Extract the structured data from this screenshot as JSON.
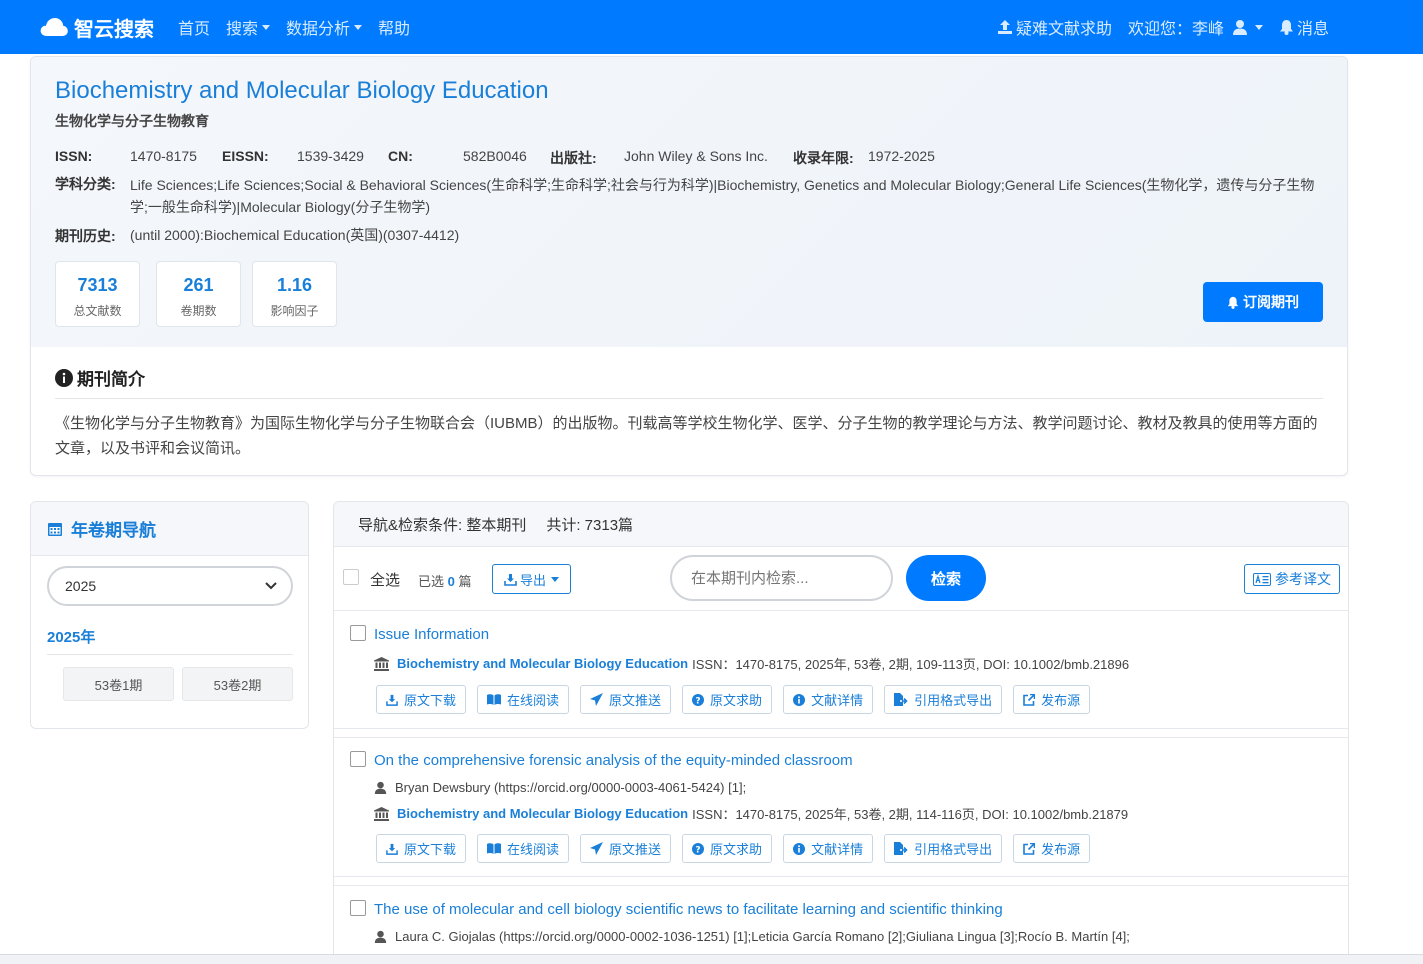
{
  "nav": {
    "brand": "智云搜索",
    "items": [
      "首页",
      "搜索",
      "数据分析",
      "帮助"
    ],
    "help_request": "疑难文献求助",
    "welcome": "欢迎您：李峰",
    "messages": "消息"
  },
  "journal": {
    "title": "Biochemistry and Molecular Biology Education",
    "subtitle": "生物化学与分子生物教育",
    "issn_label": "ISSN:",
    "issn": "1470-8175",
    "eissn_label": "EISSN:",
    "eissn": "1539-3429",
    "cn_label": "CN:",
    "cn": "582B0046",
    "publisher_label": "出版社:",
    "publisher": "John Wiley & Sons Inc.",
    "years_label": "收录年限:",
    "years": "1972-2025",
    "subject_label": "学科分类:",
    "subject": "Life Sciences;Life Sciences;Social & Behavioral Sciences(生命科学;生命科学;社会与行为科学)|Biochemistry, Genetics and Molecular Biology;General Life Sciences(生物化学，遗传与分子生物学;一般生命科学)|Molecular Biology(分子生物学)",
    "history_label": "期刊历史:",
    "history": "(until 2000):Biochemical Education(英国)(0307-4412)",
    "stats": [
      {
        "num": "7313",
        "label": "总文献数"
      },
      {
        "num": "261",
        "label": "卷期数"
      },
      {
        "num": "1.16",
        "label": "影响因子"
      }
    ],
    "subscribe": "订阅期刊",
    "intro_title": "期刊简介",
    "intro_text": "《生物化学与分子生物教育》为国际生物化学与分子生物联合会（IUBMB）的出版物。刊载高等学校生物化学、医学、分子生物的教学理论与方法、教学问题讨论、教材及教具的使用等方面的文章，以及书评和会议简讯。"
  },
  "sidebar": {
    "title": "年卷期导航",
    "selected_year": "2025",
    "year_label": "2025年",
    "issues": [
      "53卷1期",
      "53卷2期"
    ]
  },
  "results": {
    "condition_label": "导航&检索条件: 整本期刊",
    "total_label": "共计: 7313篇",
    "select_all": "全选",
    "selected_prefix": "已选",
    "selected_count": "0",
    "selected_suffix": "篇",
    "export": "导出",
    "search_placeholder": "在本期刊内检索...",
    "search_button": "检索",
    "translate": "参考译文",
    "actions": [
      "原文下载",
      "在线阅读",
      "原文推送",
      "原文求助",
      "文献详情",
      "引用格式导出",
      "发布源"
    ],
    "items": [
      {
        "title": "Issue Information",
        "source": "Biochemistry and Molecular Biology Education",
        "meta": "ISSN：1470-8175, 2025年, 53卷, 2期, 109-113页, DOI: 10.1002/bmb.21896"
      },
      {
        "title": "On the comprehensive forensic analysis of the equity-minded classroom",
        "authors": "Bryan Dewsbury (https://orcid.org/0000-0003-4061-5424) [1];",
        "source": "Biochemistry and Molecular Biology Education",
        "meta": "ISSN：1470-8175, 2025年, 53卷, 2期, 114-116页, DOI: 10.1002/bmb.21879"
      },
      {
        "title": "The use of molecular and cell biology scientific news to facilitate learning and scientific thinking",
        "authors": "Laura C. Giojalas (https://orcid.org/0000-0002-1036-1251) [1];Leticia García Romano [2];Giuliana Lingua [3];Rocío B. Martín [4];"
      }
    ]
  }
}
